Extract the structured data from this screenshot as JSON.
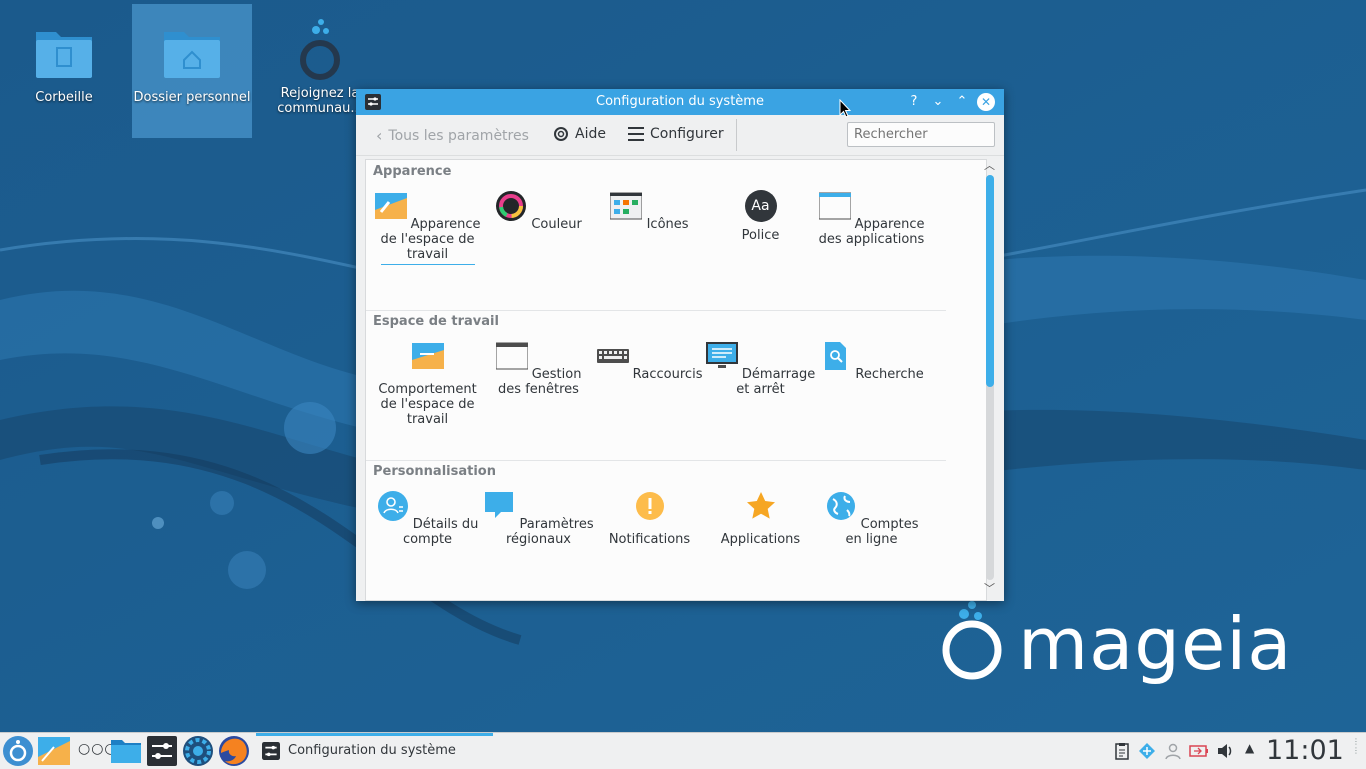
{
  "desktop": {
    "icons": [
      {
        "label": "Corbeille"
      },
      {
        "label": "Dossier personnel"
      },
      {
        "label": "Rejoignez la communau..."
      }
    ],
    "brand": "mageia"
  },
  "window": {
    "title": "Configuration du système",
    "buttons": {
      "help": "?",
      "minimize": "⌄",
      "maximize": "⌃",
      "close": "✕"
    },
    "toolbar": {
      "back_label": "Tous les paramètres",
      "help_label": "Aide",
      "configure_label": "Configurer",
      "search_placeholder": "Rechercher"
    },
    "sections": [
      {
        "title": "Apparence",
        "items": [
          {
            "label": "Apparence de l'espace de travail",
            "icon": "workspace-theme-icon"
          },
          {
            "label": "Couleur",
            "icon": "color-icon"
          },
          {
            "label": "Icônes",
            "icon": "icons-icon"
          },
          {
            "label": "Police",
            "icon": "font-icon",
            "glyph": "Aa"
          },
          {
            "label": "Apparence des applications",
            "icon": "app-style-icon"
          }
        ]
      },
      {
        "title": "Espace de travail",
        "items": [
          {
            "label": "Comportement de l'espace de travail",
            "icon": "workspace-behavior-icon"
          },
          {
            "label": "Gestion des fenêtres",
            "icon": "window-management-icon"
          },
          {
            "label": "Raccourcis",
            "icon": "keyboard-icon"
          },
          {
            "label": "Démarrage et arrêt",
            "icon": "startup-shutdown-icon"
          },
          {
            "label": "Recherche",
            "icon": "search-document-icon"
          }
        ]
      },
      {
        "title": "Personnalisation",
        "items": [
          {
            "label": "Détails du compte",
            "icon": "account-icon"
          },
          {
            "label": "Paramètres régionaux",
            "icon": "regional-icon"
          },
          {
            "label": "Notifications",
            "icon": "notifications-icon"
          },
          {
            "label": "Applications",
            "icon": "applications-star-icon"
          },
          {
            "label": "Comptes en ligne",
            "icon": "online-accounts-globe-icon"
          }
        ]
      }
    ]
  },
  "taskbar": {
    "active_task": "Configuration du système",
    "clock": "11:01",
    "launchers": [
      "mageia-menu-icon",
      "pager-icon",
      "more-icon",
      "file-manager-icon",
      "system-settings-icon",
      "control-center-icon",
      "firefox-icon"
    ],
    "tray": [
      "clipboard-icon",
      "updates-icon",
      "user-icon",
      "battery-icon",
      "volume-icon",
      "expand-tray-icon"
    ]
  },
  "colors": {
    "accent": "#3daee9",
    "titlebar": "#3aa3e3",
    "desktop": "#1d5b8c"
  }
}
